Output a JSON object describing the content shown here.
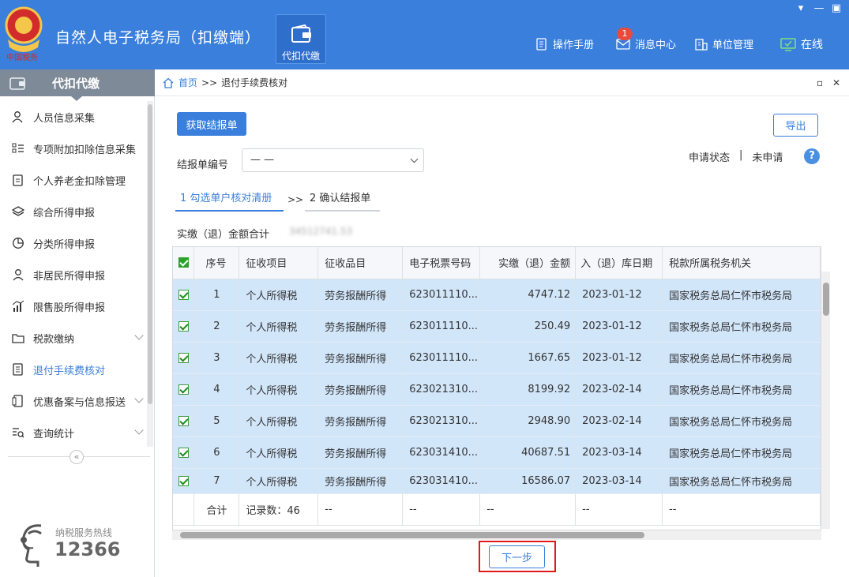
{
  "header": {
    "app_title": "自然人电子税务局（扣缴端）",
    "module_tile_label": "代扣代缴",
    "nav": {
      "manual": "操作手册",
      "messages": "消息中心",
      "message_count": "1",
      "unit_mgmt": "单位管理",
      "online": "在线"
    }
  },
  "sidebar": {
    "title": "代扣代缴",
    "items": [
      {
        "label": "人员信息采集"
      },
      {
        "label": "专项附加扣除信息采集"
      },
      {
        "label": "个人养老金扣除管理"
      },
      {
        "label": "综合所得申报"
      },
      {
        "label": "分类所得申报"
      },
      {
        "label": "非居民所得申报"
      },
      {
        "label": "限售股所得申报"
      },
      {
        "label": "税款缴纳"
      },
      {
        "label": "退付手续费核对"
      },
      {
        "label": "优惠备案与信息报送"
      },
      {
        "label": "查询统计"
      }
    ],
    "hotline_label": "纳税服务热线",
    "hotline_number": "12366"
  },
  "breadcrumb": {
    "home": "首页",
    "separator": ">>",
    "current": "退付手续费核对"
  },
  "toolbar": {
    "fetch_label": "获取结报单",
    "export_label": "导出"
  },
  "form": {
    "report_no_label": "结报单编号",
    "report_no_value": "— —",
    "status_label": "申请状态",
    "status_sep": "|",
    "status_value": "未申请",
    "help": "?"
  },
  "steps": {
    "step1": "1 勾选单户核对清册",
    "arrow": ">>",
    "step2": "2 确认结报单"
  },
  "total": {
    "label": "实缴（退）金额合计",
    "value": "34512741.53"
  },
  "table": {
    "columns": [
      "序号",
      "征收项目",
      "征收品目",
      "电子税票号码",
      "实缴（退）金额",
      "入（退）库日期",
      "税款所属税务机关"
    ],
    "rows": [
      {
        "no": "1",
        "item": "个人所得税",
        "category": "劳务报酬所得",
        "ticket": "623011110...",
        "amount": "4747.12",
        "date": "2023-01-12",
        "office": "国家税务总局仁怀市税务局"
      },
      {
        "no": "2",
        "item": "个人所得税",
        "category": "劳务报酬所得",
        "ticket": "623011110...",
        "amount": "250.49",
        "date": "2023-01-12",
        "office": "国家税务总局仁怀市税务局"
      },
      {
        "no": "3",
        "item": "个人所得税",
        "category": "劳务报酬所得",
        "ticket": "623011110...",
        "amount": "1667.65",
        "date": "2023-01-12",
        "office": "国家税务总局仁怀市税务局"
      },
      {
        "no": "4",
        "item": "个人所得税",
        "category": "劳务报酬所得",
        "ticket": "623021310...",
        "amount": "8199.92",
        "date": "2023-02-14",
        "office": "国家税务总局仁怀市税务局"
      },
      {
        "no": "5",
        "item": "个人所得税",
        "category": "劳务报酬所得",
        "ticket": "623021310...",
        "amount": "2948.90",
        "date": "2023-02-14",
        "office": "国家税务总局仁怀市税务局"
      },
      {
        "no": "6",
        "item": "个人所得税",
        "category": "劳务报酬所得",
        "ticket": "623031410...",
        "amount": "40687.51",
        "date": "2023-03-14",
        "office": "国家税务总局仁怀市税务局"
      },
      {
        "no": "7",
        "item": "个人所得税",
        "category": "劳务报酬所得",
        "ticket": "623031410...",
        "amount": "16586.07",
        "date": "2023-03-14",
        "office": "国家税务总局仁怀市税务局"
      }
    ],
    "summary": {
      "label": "合计",
      "records": "记录数：46",
      "dash": "--"
    }
  },
  "next_label": "下一步",
  "colors": {
    "primary": "#3a7fdc",
    "row_selected": "#d2e6fa",
    "highlight": "#e01818"
  }
}
